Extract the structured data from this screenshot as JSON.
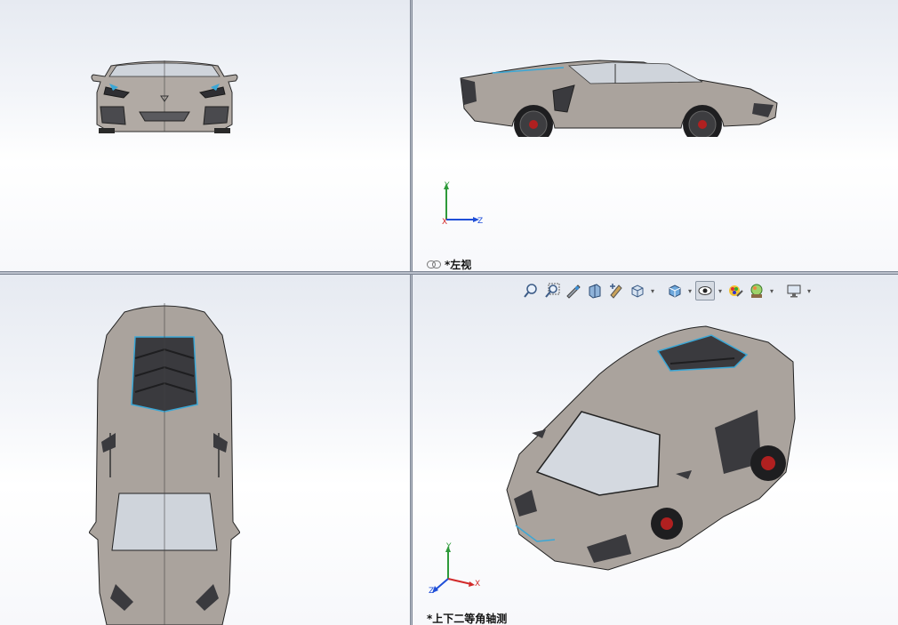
{
  "viewports": {
    "front": {
      "label": ""
    },
    "left": {
      "label": "*左视"
    },
    "top": {
      "label": ""
    },
    "iso": {
      "label": "*上下二等角轴测"
    }
  },
  "triad": {
    "y_label": "Y",
    "z_label": "Z",
    "x_label": "X"
  },
  "toolbar": {
    "buttons": [
      {
        "icon": "zoom-to-fit-icon",
        "dropdown": false
      },
      {
        "icon": "zoom-to-area-icon",
        "dropdown": false
      },
      {
        "icon": "previous-view-icon",
        "dropdown": false
      },
      {
        "icon": "section-view-icon",
        "dropdown": false
      },
      {
        "icon": "dynamic-annotation-icon",
        "dropdown": false
      },
      {
        "icon": "view-orientation-icon",
        "dropdown": true
      },
      {
        "icon": "display-style-icon",
        "dropdown": true
      },
      {
        "icon": "hide-show-items-icon",
        "dropdown": true,
        "active": true
      },
      {
        "icon": "edit-appearance-icon",
        "dropdown": false
      },
      {
        "icon": "apply-scene-icon",
        "dropdown": true
      },
      {
        "icon": "view-settings-icon",
        "dropdown": true
      }
    ]
  },
  "colors": {
    "car_body": "#a9a29c",
    "car_dark": "#3a3a3c",
    "accent_blue": "#3aa7d6",
    "axis_y": "#2e9a3a",
    "axis_z": "#1f4fd8",
    "axis_x": "#d22a2a"
  }
}
